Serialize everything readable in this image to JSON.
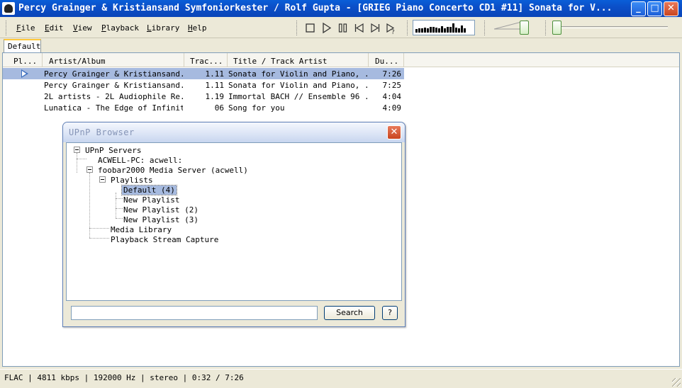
{
  "window": {
    "title": "Percy Grainger & Kristiansand Symfoniorkester / Rolf Gupta - [GRIEG Piano Concerto CD1 #11] Sonata for V...",
    "minimize_label": "_",
    "maximize_label": "□",
    "close_label": "✕"
  },
  "menu": {
    "file": {
      "accel": "F",
      "rest": "ile"
    },
    "edit": {
      "accel": "E",
      "rest": "dit"
    },
    "view": {
      "accel": "V",
      "rest": "iew"
    },
    "playback": {
      "accel": "P",
      "rest": "layback"
    },
    "library": {
      "accel": "L",
      "rest": "ibrary"
    },
    "help": {
      "accel": "H",
      "rest": "elp"
    }
  },
  "toolbar": {
    "icons": [
      "stop-icon",
      "play-icon",
      "pause-icon",
      "previous-icon",
      "next-icon",
      "random-icon"
    ],
    "visualizer_levels": [
      0.35,
      0.45,
      0.4,
      0.5,
      0.45,
      0.55,
      0.6,
      0.5,
      0.45,
      0.65,
      0.4,
      0.55,
      0.6,
      0.9,
      0.5,
      0.45,
      0.7,
      0.4
    ]
  },
  "tabs": [
    {
      "label": "Default"
    }
  ],
  "playlist": {
    "columns": [
      "Pl...",
      "Artist/Album",
      "Trac...",
      "Title / Track Artist",
      "Du..."
    ],
    "rows": [
      {
        "artist": "Percy Grainger & Kristiansand...",
        "track": "1.11",
        "title": "Sonata for Violin and Piano, ...",
        "duration": "7:26",
        "playing": true,
        "selected": true
      },
      {
        "artist": "Percy Grainger & Kristiansand...",
        "track": "1.11",
        "title": "Sonata for Violin and Piano, ...",
        "duration": "7:25",
        "playing": false,
        "selected": false
      },
      {
        "artist": "2L artists - 2L Audiophile Re...",
        "track": "1.19",
        "title": "Immortal BACH // Ensemble 96 ...",
        "duration": "4:04",
        "playing": false,
        "selected": false
      },
      {
        "artist": "Lunatica - The Edge of Infinity",
        "track": "06",
        "title": "Song for you",
        "duration": "4:09",
        "playing": false,
        "selected": false
      }
    ]
  },
  "upnp_dialog": {
    "title": "UPnP Browser",
    "close_label": "✕",
    "tree": {
      "root": "UPnP Servers",
      "server1": "ACWELL-PC: acwell:",
      "server2": "foobar2000 Media Server (acwell)",
      "playlists": "Playlists",
      "playlist_items": [
        "Default (4)",
        "New Playlist",
        "New Playlist (2)",
        "New Playlist (3)"
      ],
      "media_library": "Media Library",
      "stream_capture": "Playback Stream Capture"
    },
    "search_placeholder": "",
    "search_button": "Search",
    "help_button": "?"
  },
  "status": {
    "text": "FLAC | 4811 kbps | 192000 Hz | stereo | 0:32 / 7:26"
  }
}
